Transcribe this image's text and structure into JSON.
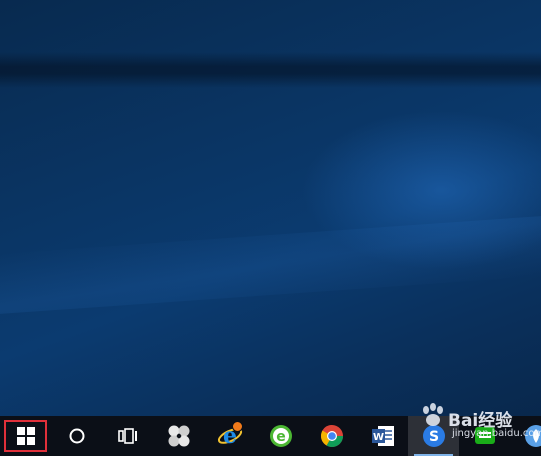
{
  "desktop": {
    "background_colors": {
      "base": "#0a3564",
      "dark": "#082547",
      "highlight": "#2878d2"
    }
  },
  "taskbar": {
    "background": "#0b0f17",
    "highlight_color": "#e0303a",
    "items": [
      {
        "name": "start",
        "icon": "windows-logo-icon",
        "highlighted": true
      },
      {
        "name": "search",
        "icon": "cortana-circle-icon"
      },
      {
        "name": "task-view",
        "icon": "task-view-icon"
      },
      {
        "name": "app-pinwheel",
        "icon": "pinwheel-icon"
      },
      {
        "name": "internet-explorer",
        "icon": "ie-icon",
        "badge": true
      },
      {
        "name": "360-browser",
        "icon": "green-e-browser-icon"
      },
      {
        "name": "chrome",
        "icon": "chrome-icon"
      },
      {
        "name": "word",
        "icon": "word-icon"
      },
      {
        "name": "sogou",
        "icon": "sogou-icon",
        "active": true
      },
      {
        "name": "chat-app",
        "icon": "green-chat-icon"
      },
      {
        "name": "blue-app",
        "icon": "blue-circle-app-icon"
      }
    ]
  },
  "watermark": {
    "brand": "Bai",
    "chinese": "经验",
    "url": "jingyan.baidu.com"
  }
}
